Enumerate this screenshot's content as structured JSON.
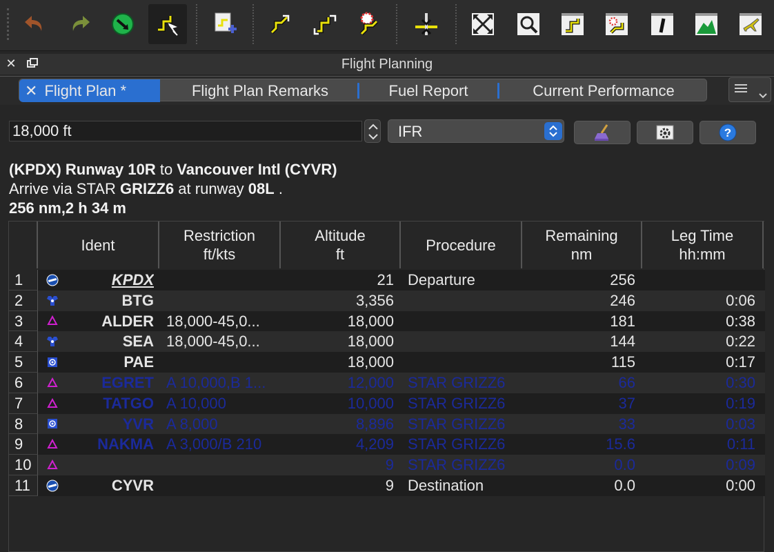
{
  "window": {
    "title": "Flight Planning"
  },
  "tabs": [
    {
      "label": "Flight Plan *",
      "active": true
    },
    {
      "label": "Flight Plan Remarks"
    },
    {
      "label": "Fuel Report"
    },
    {
      "label": "Current Performance"
    }
  ],
  "controls": {
    "altitude_value": "18,000 ft",
    "flight_rules": "IFR"
  },
  "route": {
    "line1_dep_prefix": "(KPDX) Runway 10R",
    "line1_to": " to ",
    "line1_dest": "Vancouver Intl (CYVR)",
    "line2_prefix": "Arrive via STAR ",
    "line2_star": "GRIZZ6",
    "line2_mid": " at runway ",
    "line2_rwy": "08L",
    "line2_end": " .",
    "line3": "256 nm,2 h 34 m"
  },
  "table": {
    "headers": {
      "ident": "Ident",
      "restriction_1": "Restriction",
      "restriction_2": "ft/kts",
      "altitude_1": "Altitude",
      "altitude_2": "ft",
      "procedure": "Procedure",
      "remaining_1": "Remaining",
      "remaining_2": "nm",
      "legtime_1": "Leg Time",
      "legtime_2": "hh:mm"
    },
    "rows": [
      {
        "num": "1",
        "icon": "airport-icon",
        "ident": "KPDX",
        "restriction": "",
        "altitude": "21",
        "procedure": "Departure",
        "remaining": "256",
        "leg_time": ""
      },
      {
        "num": "2",
        "icon": "vordme-icon",
        "ident": "BTG",
        "restriction": "",
        "altitude": "3,356",
        "procedure": "",
        "remaining": "246",
        "leg_time": "0:06"
      },
      {
        "num": "3",
        "icon": "waypoint-icon",
        "ident": "ALDER",
        "restriction": "18,000-45,0...",
        "altitude": "18,000",
        "procedure": "",
        "remaining": "181",
        "leg_time": "0:38"
      },
      {
        "num": "4",
        "icon": "vordme-icon",
        "ident": "SEA",
        "restriction": "18,000-45,0...",
        "altitude": "18,000",
        "procedure": "",
        "remaining": "144",
        "leg_time": "0:22"
      },
      {
        "num": "5",
        "icon": "vor-icon",
        "ident": "PAE",
        "restriction": "",
        "altitude": "18,000",
        "procedure": "",
        "remaining": "115",
        "leg_time": "0:17"
      },
      {
        "num": "6",
        "icon": "waypoint-icon",
        "ident": "EGRET",
        "restriction": "A 10,000,B 1...",
        "altitude": "12,000",
        "procedure": "STAR GRIZZ6",
        "remaining": "66",
        "leg_time": "0:30"
      },
      {
        "num": "7",
        "icon": "waypoint-icon",
        "ident": "TATGO",
        "restriction": "A 10,000",
        "altitude": "10,000",
        "procedure": "STAR GRIZZ6",
        "remaining": "37",
        "leg_time": "0:19"
      },
      {
        "num": "8",
        "icon": "vor-icon",
        "ident": "YVR",
        "restriction": "A 8,000",
        "altitude": "8,896",
        "procedure": "STAR GRIZZ6",
        "remaining": "33",
        "leg_time": "0:03"
      },
      {
        "num": "9",
        "icon": "waypoint-icon",
        "ident": "NAKMA",
        "restriction": "A 3,000/B 210",
        "altitude": "4,209",
        "procedure": "STAR GRIZZ6",
        "remaining": "15.6",
        "leg_time": "0:11"
      },
      {
        "num": "10",
        "icon": "waypoint-icon",
        "ident": "",
        "restriction": "",
        "altitude": "9",
        "procedure": "STAR GRIZZ6",
        "remaining": "0.0",
        "leg_time": "0:09"
      },
      {
        "num": "11",
        "icon": "airport-icon",
        "ident": "CYVR",
        "restriction": "",
        "altitude": "9",
        "procedure": "Destination",
        "remaining": "0.0",
        "leg_time": "0:00"
      }
    ]
  },
  "colors": {
    "accent": "#2a6fd0",
    "procedure_text": "#1b2a9a",
    "waypoint": "#d020d0",
    "vor": "#2a4fd0"
  }
}
